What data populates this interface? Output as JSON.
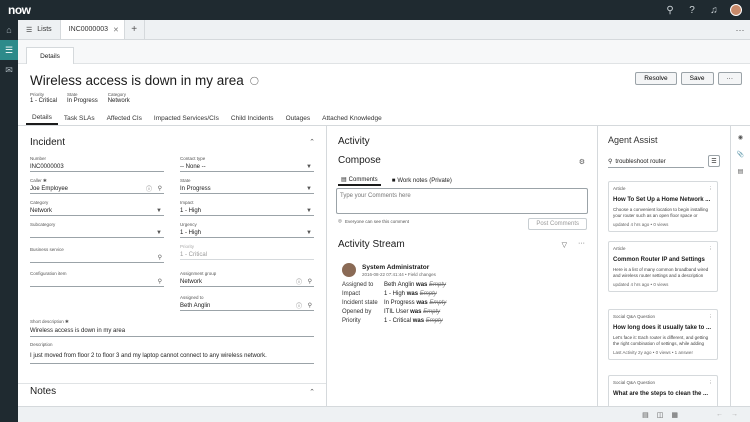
{
  "topbar": {
    "logo": "now",
    "icons": [
      "search-icon",
      "help-icon",
      "bell-icon"
    ]
  },
  "rail": {
    "items": [
      "home-icon",
      "list-icon",
      "inbox-icon"
    ]
  },
  "tabs": {
    "lists_label": "Lists",
    "record_label": "INC0000003",
    "plus": "+",
    "more": "···"
  },
  "subtab": {
    "label": "Details"
  },
  "header": {
    "title": "Wireless access is down in my area",
    "resolve": "Resolve",
    "save": "Save",
    "more": "···",
    "meta": [
      {
        "label": "Priority",
        "value": "1 - Critical"
      },
      {
        "label": "State",
        "value": "In Progress"
      },
      {
        "label": "Category",
        "value": "Network"
      }
    ]
  },
  "form_tabs": [
    "Details",
    "Task SLAs",
    "Affected CIs",
    "Impacted Services/CIs",
    "Child Incidents",
    "Outages",
    "Attached Knowledge"
  ],
  "incident": {
    "section_title": "Incident",
    "notes_title": "Notes",
    "left_fields": [
      {
        "label": "Number",
        "value": "INC0000003"
      },
      {
        "label": "Caller ✱",
        "value": "Joe Employee"
      },
      {
        "label": "Category",
        "value": "Network"
      },
      {
        "label": "Subcategory",
        "value": ""
      },
      {
        "label": "Business service",
        "value": ""
      },
      {
        "label": "Configuration item",
        "value": ""
      }
    ],
    "right_fields": [
      {
        "label": "Contact type",
        "value": "-- None --"
      },
      {
        "label": "State",
        "value": "In Progress"
      },
      {
        "label": "Impact",
        "value": "1 - High"
      },
      {
        "label": "Urgency",
        "value": "1 - High"
      },
      {
        "label": "Priority",
        "value": "1 - Critical"
      },
      {
        "label": "Assignment group",
        "value": "Network"
      },
      {
        "label": "Assigned to",
        "value": "Beth Anglin"
      }
    ],
    "short_desc_label": "Short description ✱",
    "short_desc_value": "Wireless access is down in my area",
    "desc_label": "Description",
    "desc_value": "I just moved from floor 2 to floor 3 and my laptop cannot connect to any wireless network."
  },
  "activity": {
    "title": "Activity",
    "compose": "Compose",
    "tab_comments": "Comments",
    "tab_worknotes": "Work notes (Private)",
    "placeholder": "Type your Comments here",
    "visibility": "Everyone can see this comment",
    "post": "Post Comments",
    "stream_title": "Activity Stream",
    "entry": {
      "name": "System Administrator",
      "time": "2016-08-22 07:41:44  •  Field changes",
      "rows": [
        {
          "k": "Assigned to",
          "v": "Beth Anglin",
          "was": "was",
          "old": "Empty"
        },
        {
          "k": "Impact",
          "v": "1 - High",
          "was": "was",
          "old": "Empty"
        },
        {
          "k": "Incident state",
          "v": "In Progress",
          "was": "was",
          "old": "Empty"
        },
        {
          "k": "Opened by",
          "v": "ITIL User",
          "was": "was",
          "old": "Empty"
        },
        {
          "k": "Priority",
          "v": "1 - Critical",
          "was": "was",
          "old": "Empty"
        }
      ]
    }
  },
  "agent_assist": {
    "title": "Agent Assist",
    "search": "troubleshoot router",
    "cards": [
      {
        "type": "Article",
        "title": "How To Set Up a Home Network ...",
        "desc": "Choose a convenient location to begin installing your router such as an open floor space or",
        "foot": "updated 4 hrs ago  •  0 views"
      },
      {
        "type": "Article",
        "title": "Common Router IP and Settings",
        "desc": "Here is a list of many common broadband wired and wireless router settings and a description",
        "foot": "updated 4 hrs ago  •  0 views"
      },
      {
        "type": "Social Q&A Question",
        "title": "How long does it usually take to ...",
        "desc": "Let's face it: Each router is different, and getting the right combination of settings, while adding",
        "foot": "Last Activity 2y ago  •  0 views  •  1 answer"
      },
      {
        "type": "Social Q&A Question",
        "title": "What are the steps to clean the ...",
        "desc": "",
        "foot": ""
      }
    ]
  }
}
